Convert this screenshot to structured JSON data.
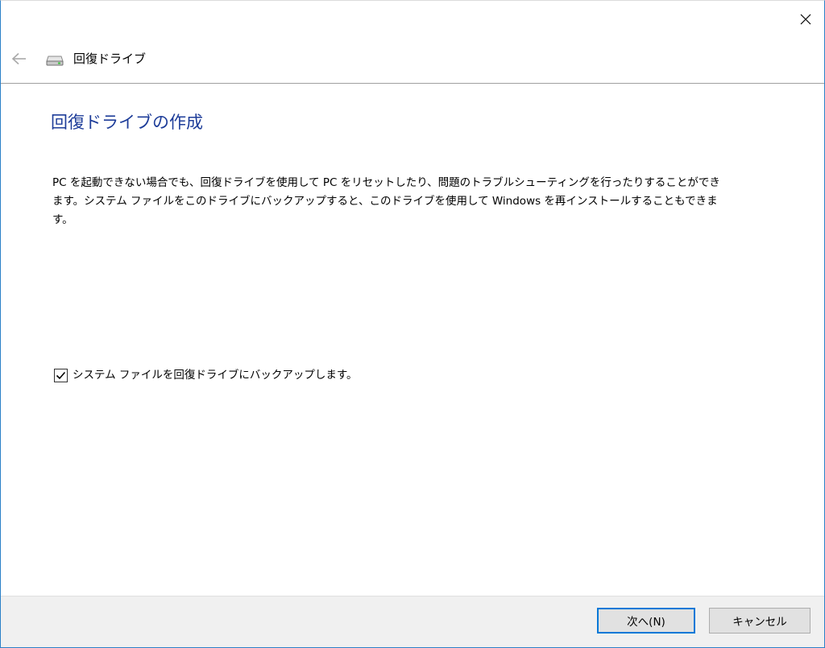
{
  "window": {
    "nav_title": "回復ドライブ"
  },
  "icons": {
    "close": "close-icon",
    "back": "back-arrow-icon",
    "drive": "drive-icon",
    "checkmark": "checkmark-icon"
  },
  "main": {
    "heading": "回復ドライブの作成",
    "description": "PC を起動できない場合でも、回復ドライブを使用して PC をリセットしたり、問題のトラブルシューティングを行ったりすることができます。システム ファイルをこのドライブにバックアップすると、このドライブを使用して Windows を再インストールすることもできます。",
    "checkbox": {
      "label": "システム ファイルを回復ドライブにバックアップします。",
      "checked": true
    }
  },
  "footer": {
    "next_label": "次へ(N)",
    "cancel_label": "キャンセル"
  },
  "colors": {
    "heading": "#1e3d99",
    "accent": "#0078d7",
    "window_border": "#2b80c8",
    "footer_bg": "#f0f0f0",
    "button_bg": "#e1e1e1"
  }
}
